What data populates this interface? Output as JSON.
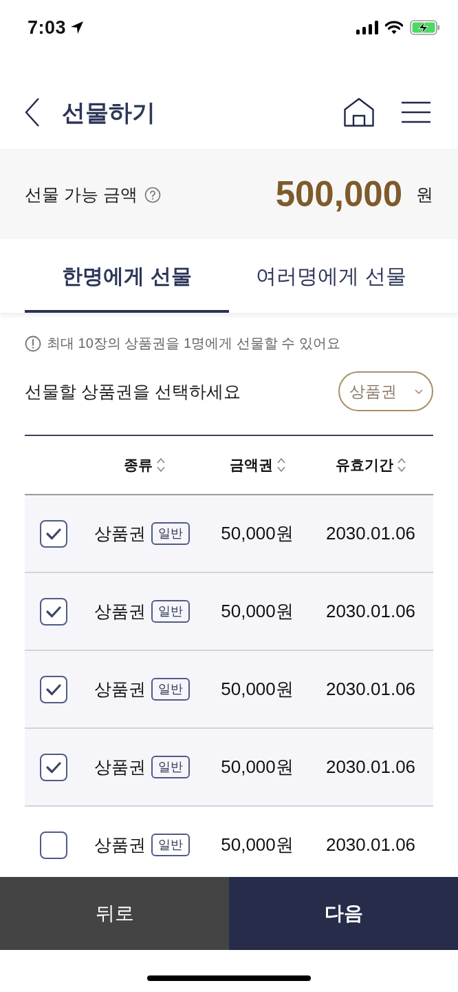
{
  "status_bar": {
    "time": "7:03"
  },
  "header": {
    "title": "선물하기"
  },
  "balance": {
    "label": "선물 가능 금액",
    "amount": "500,000",
    "unit": "원"
  },
  "tabs": [
    {
      "label": "한명에게 선물",
      "selected": true
    },
    {
      "label": "여러명에게 선물",
      "selected": false
    }
  ],
  "notice": "최대 10장의 상품권을 1명에게 선물할 수 있어요",
  "selection": {
    "prompt": "선물할 상품권을 선택하세요",
    "filter": "상품권"
  },
  "table": {
    "columns": [
      "종류",
      "금액권",
      "유효기간"
    ],
    "rows": [
      {
        "voucher": "상품권",
        "badge": "일반",
        "amount": "50,000원",
        "expiry": "2030.01.06",
        "checked": true
      },
      {
        "voucher": "상품권",
        "badge": "일반",
        "amount": "50,000원",
        "expiry": "2030.01.06",
        "checked": true
      },
      {
        "voucher": "상품권",
        "badge": "일반",
        "amount": "50,000원",
        "expiry": "2030.01.06",
        "checked": true
      },
      {
        "voucher": "상품권",
        "badge": "일반",
        "amount": "50,000원",
        "expiry": "2030.01.06",
        "checked": true
      },
      {
        "voucher": "상품권",
        "badge": "일반",
        "amount": "50,000원",
        "expiry": "2030.01.06",
        "checked": false
      }
    ]
  },
  "footer": {
    "buttons": [
      {
        "label": "뒤로",
        "kind": "secondary"
      },
      {
        "label": "다음",
        "kind": "primary"
      }
    ]
  }
}
